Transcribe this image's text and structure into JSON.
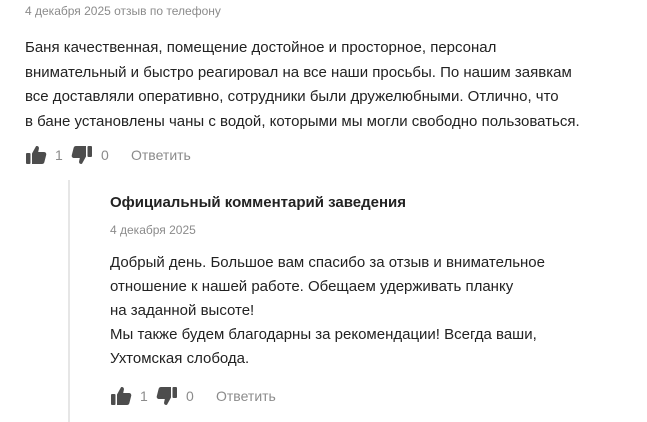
{
  "review": {
    "meta": "4 декабря 2025 отзыв по телефону",
    "text_lines": [
      "Баня качественная, помещение достойное и просторное, персонал",
      "внимательный и быстро реагировал на все наши просьбы. По нашим заявкам",
      "все доставляли оперативно, сотрудники были дружелюбными. Отлично, что",
      "в бане установлены чаны с водой, которыми мы могли свободно пользоваться."
    ],
    "likes": "1",
    "dislikes": "0",
    "reply_label": "Ответить"
  },
  "owner_reply": {
    "title": "Официальный комментарий заведения",
    "date": "4 декабря 2025",
    "text_lines": [
      "Добрый день. Большое вам спасибо за отзыв и внимательное",
      "отношение к нашей работе. Обещаем удерживать планку",
      "на заданной высоте!",
      "Мы также будем благодарны за рекомендации! Всегда ваши,",
      "Ухтомская слобода."
    ],
    "likes": "1",
    "dislikes": "0",
    "reply_label": "Ответить"
  },
  "icons": {
    "like": "thumbs-up-icon",
    "dislike": "thumbs-down-icon"
  },
  "colors": {
    "text": "#222222",
    "muted": "#8b8b8b",
    "icon": "#4d4d4d",
    "divider": "#e6e6e6"
  }
}
